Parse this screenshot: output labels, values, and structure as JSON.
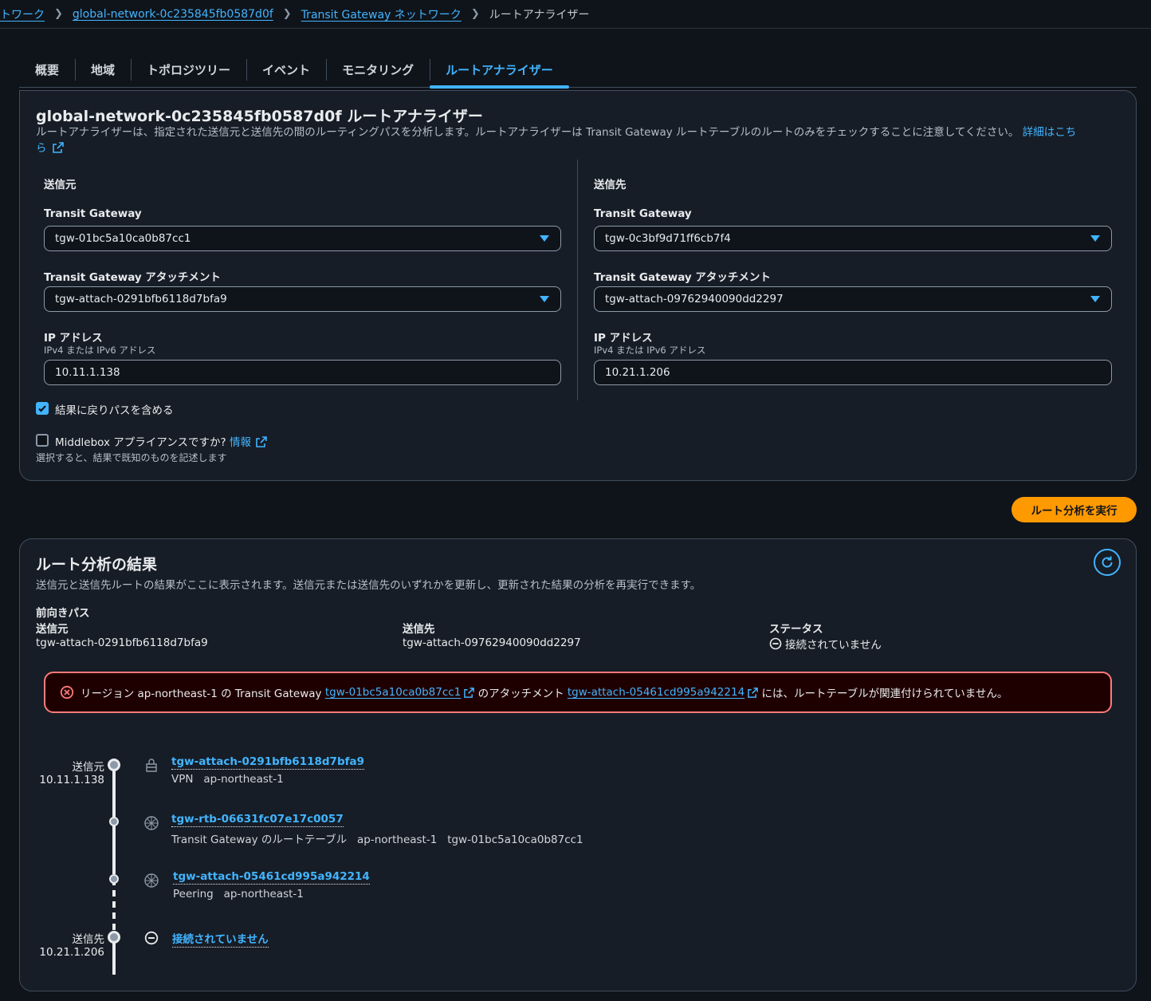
{
  "breadcrumb": {
    "items": [
      "トワーク",
      "global-network-0c235845fb0587d0f",
      "Transit Gateway ネットワーク"
    ],
    "current": "ルートアナライザー"
  },
  "tabs": [
    "概要",
    "地域",
    "トポロジツリー",
    "イベント",
    "モニタリング",
    "ルートアナライザー"
  ],
  "analyzer": {
    "title": "global-network-0c235845fb0587d0f ルートアナライザー",
    "description": "ルートアナライザーは、指定された送信元と送信先の間のルーティングパスを分析します。ルートアナライザーは Transit Gateway ルートテーブルのルートのみをチェックすることに注意してください。",
    "learn_more_1": "詳細はこち",
    "learn_more_2": "ら",
    "source": {
      "heading": "送信元",
      "tgw_label": "Transit Gateway",
      "tgw_value": "tgw-01bc5a10ca0b87cc1",
      "attach_label": "Transit Gateway アタッチメント",
      "attach_value": "tgw-attach-0291bfb6118d7bfa9",
      "ip_label": "IP アドレス",
      "ip_sublabel": "IPv4 または IPv6 アドレス",
      "ip_value": "10.11.1.138"
    },
    "destination": {
      "heading": "送信先",
      "tgw_label": "Transit Gateway",
      "tgw_value": "tgw-0c3bf9d71ff6cb7f4",
      "attach_label": "Transit Gateway アタッチメント",
      "attach_value": "tgw-attach-09762940090dd2297",
      "ip_label": "IP アドレス",
      "ip_sublabel": "IPv4 または IPv6 アドレス",
      "ip_value": "10.21.1.206"
    },
    "return_path_label": "結果に戻りパスを含める",
    "return_path_checked": true,
    "middlebox_label": "Middlebox アプライアンスですか?",
    "middlebox_info": "情報",
    "middlebox_checked": false,
    "middlebox_desc": "選択すると、結果で既知のものを記述します",
    "run_button": "ルート分析を実行"
  },
  "results": {
    "title": "ルート分析の結果",
    "description": "送信元と送信先ルートの結果がここに表示されます。送信元または送信先のいずれかを更新し、更新された結果の分析を再実行できます。",
    "forward_path_label": "前向きパス",
    "source_label": "送信元",
    "source_value": "tgw-attach-0291bfb6118d7bfa9",
    "dest_label": "送信先",
    "dest_value": "tgw-attach-09762940090dd2297",
    "status_label": "ステータス",
    "status_value": "接続されていません",
    "alert": {
      "part1": "リージョン ap-northeast-1 の Transit Gateway",
      "link1": "tgw-01bc5a10ca0b87cc1",
      "part2": "のアタッチメント",
      "link2": "tgw-attach-05461cd995a942214",
      "part3": "には、ルートテーブルが関連付けられていません。"
    },
    "timeline": {
      "start_label": "送信元",
      "start_ip": "10.11.1.138",
      "end_label": "送信先",
      "end_ip": "10.21.1.206",
      "steps": [
        {
          "link": "tgw-attach-0291bfb6118d7bfa9",
          "meta": [
            "VPN",
            "ap-northeast-1"
          ]
        },
        {
          "link": "tgw-rtb-06631fc07e17c0057",
          "meta": [
            "Transit Gateway のルートテーブル",
            "ap-northeast-1",
            "tgw-01bc5a10ca0b87cc1"
          ]
        },
        {
          "link": "tgw-attach-05461cd995a942214",
          "meta": [
            "Peering",
            "ap-northeast-1"
          ]
        },
        {
          "link": "接続されていません",
          "meta": []
        }
      ]
    }
  },
  "colors": {
    "accent": "#42b4ff",
    "primary_button": "#ff9900",
    "error": "#ff7a7a",
    "background": "#0f141a",
    "panel": "#161d26"
  }
}
